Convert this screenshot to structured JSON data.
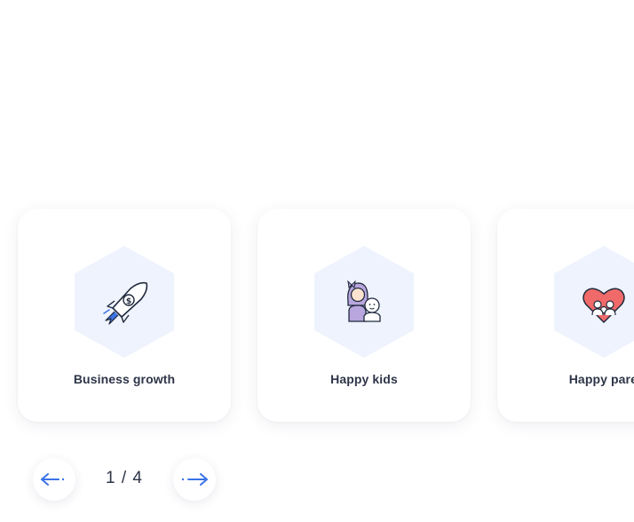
{
  "carousel": {
    "cards": [
      {
        "title": "Business growth",
        "icon": "rocket-dollar-icon"
      },
      {
        "title": "Happy kids",
        "icon": "mother-child-icon"
      },
      {
        "title": "Happy parents",
        "icon": "heart-family-icon"
      }
    ],
    "pager": {
      "current": "1",
      "separator": "/",
      "total": "4"
    },
    "prev_icon": "arrow-left-icon",
    "next_icon": "arrow-right-icon"
  },
  "colors": {
    "hex_bg": "#eef3fd",
    "accent_blue": "#3b73e6",
    "text_dark": "#2e3548",
    "heart_red": "#f06a6a"
  }
}
